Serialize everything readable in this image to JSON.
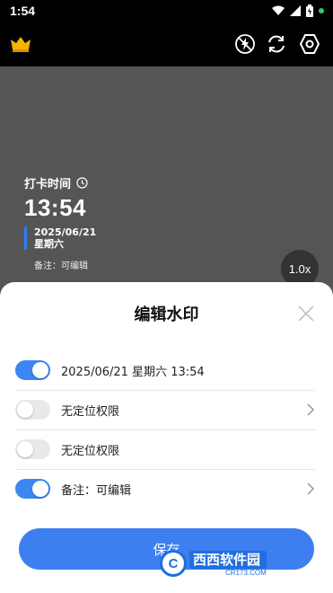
{
  "status_bar": {
    "time": "1:54",
    "icons": [
      "wifi-icon",
      "signal-icon",
      "battery-icon",
      "status-dot"
    ],
    "dot_color": "#3ec46d"
  },
  "toolbar": {
    "icons": [
      "crown-icon",
      "flash-off-icon",
      "switch-camera-icon",
      "settings-icon"
    ],
    "crown_color": "#f5b400"
  },
  "preview": {
    "title": "打卡时间",
    "time": "13:54",
    "date": "2025/06/21",
    "weekday": "星期六",
    "note": "备注：可编辑",
    "zoom": "1.0x",
    "accent": "#2f7cf6"
  },
  "sheet": {
    "title": "编辑水印",
    "rows": [
      {
        "label": "2025/06/21 星期六 13:54",
        "enabled": true,
        "has_chevron": false
      },
      {
        "label": "无定位权限",
        "enabled": false,
        "has_chevron": true
      },
      {
        "label": "无定位权限",
        "enabled": false,
        "has_chevron": false
      },
      {
        "label": "备注：可编辑",
        "enabled": true,
        "has_chevron": true
      }
    ],
    "save_label": "保存",
    "accent": "#3d7ef0"
  },
  "watermark_overlay": {
    "logo_letter": "C",
    "site_name": "西西软件园",
    "url": "CR173.COM"
  }
}
